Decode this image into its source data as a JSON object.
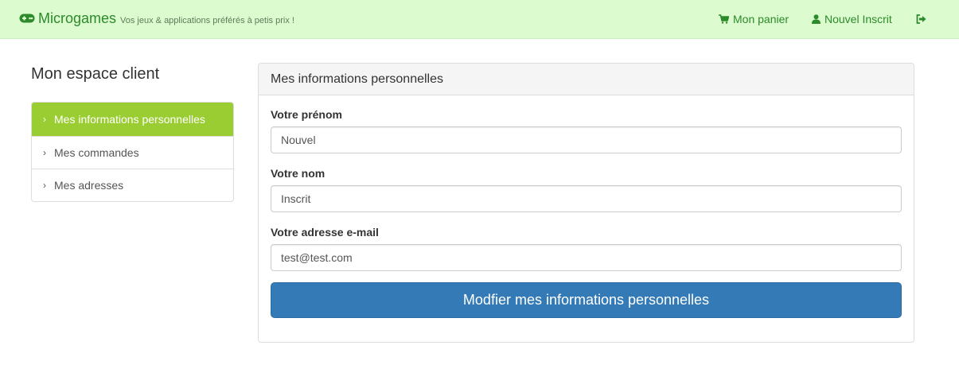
{
  "navbar": {
    "brand_icon": "gamepad-icon",
    "brand_name": "Microgames",
    "tagline": "Vos jeux & applications préférés à petis prix !",
    "cart_icon": "cart-icon",
    "cart_label": "Mon panier",
    "user_icon": "user-icon",
    "user_label": "Nouvel Inscrit",
    "logout_icon": "sign-out-icon",
    "color": "#2c8a2a",
    "background": "#dcfcd0"
  },
  "sidebar": {
    "title": "Mon espace client",
    "items": [
      {
        "label": "Mes informations personnelles",
        "active": true,
        "icon": "chevron-right-icon"
      },
      {
        "label": "Mes commandes",
        "active": false,
        "icon": "chevron-right-icon"
      },
      {
        "label": "Mes adresses",
        "active": false,
        "icon": "chevron-right-icon"
      }
    ],
    "active_color": "#9acd32"
  },
  "panel": {
    "title": "Mes informations personnelles",
    "fields": [
      {
        "label": "Votre prénom",
        "value": "Nouvel"
      },
      {
        "label": "Votre nom",
        "value": "Inscrit"
      },
      {
        "label": "Votre adresse e-mail",
        "value": "test@test.com"
      }
    ],
    "submit_label": "Modfier mes informations personnelles",
    "submit_color": "#337ab7"
  }
}
